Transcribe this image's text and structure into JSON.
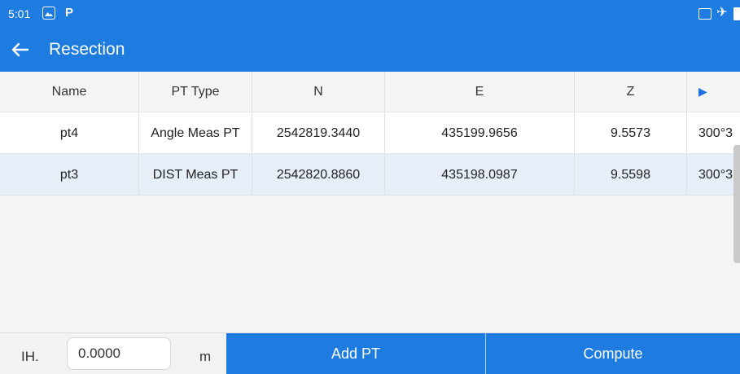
{
  "status_bar": {
    "time": "5:01",
    "icons": [
      "gallery-icon",
      "parking-icon",
      "cast-icon",
      "airplane-mode-icon",
      "battery-icon"
    ],
    "color": "#1e7ce0"
  },
  "header": {
    "title": "Resection",
    "back_icon": "arrow-left-icon"
  },
  "table": {
    "columns": [
      "Name",
      "PT Type",
      "N",
      "E",
      "Z",
      ""
    ],
    "rows": [
      {
        "name": "pt4",
        "pt_type": "Angle Meas PT",
        "n": "2542819.3440",
        "e": "435199.9656",
        "z": "9.5573",
        "h": "300°3",
        "selected": false
      },
      {
        "name": "pt3",
        "pt_type": "DIST Meas PT",
        "n": "2542820.8860",
        "e": "435198.0987",
        "z": "9.5598",
        "h": "300°3",
        "selected": true
      }
    ],
    "selected_row_color": "#e6eef8"
  },
  "footer": {
    "ih_label": "IH.",
    "ih_value": "0.0000",
    "unit": "m",
    "add_pt_label": "Add PT",
    "compute_label": "Compute",
    "accent": "#1e7ce0"
  }
}
